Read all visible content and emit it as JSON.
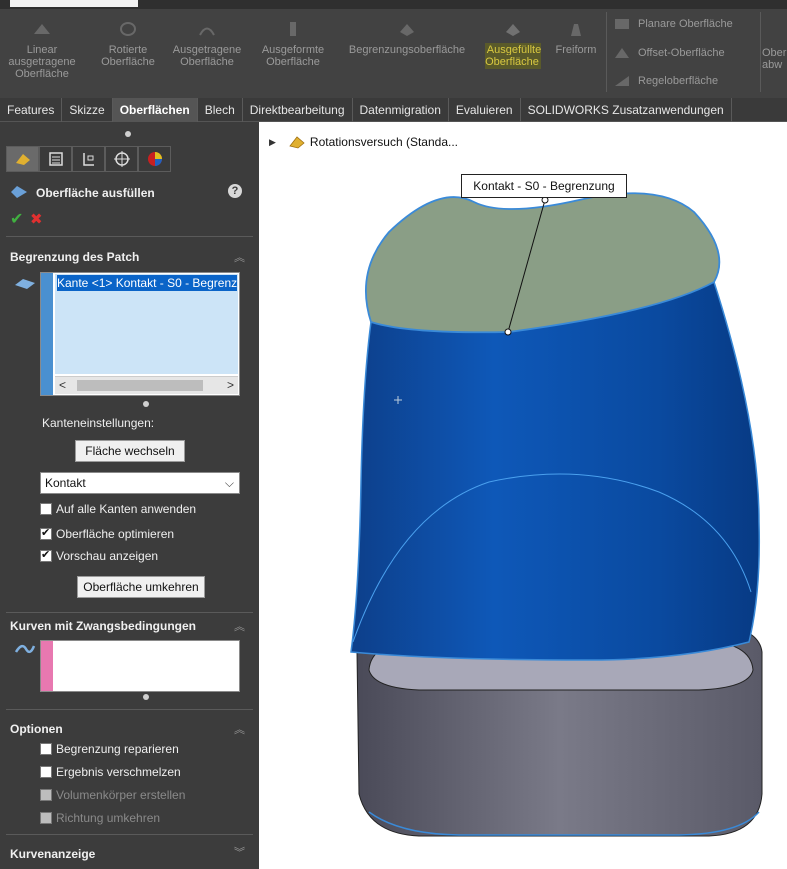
{
  "ribbon": {
    "buttons": [
      {
        "label": "Linear ausgetragene Oberfläche",
        "icon": "linear-sweep-surface-icon"
      },
      {
        "label": "Rotierte Oberfläche",
        "icon": "revolved-surface-icon"
      },
      {
        "label": "Ausgetragene Oberfläche",
        "icon": "swept-surface-icon"
      },
      {
        "label": "Ausgeformte Oberfläche",
        "icon": "lofted-surface-icon"
      },
      {
        "label": "Begrenzungsoberfläche",
        "icon": "boundary-surface-icon"
      },
      {
        "label": "Ausgefüllte Oberfläche",
        "icon": "filled-surface-icon"
      },
      {
        "label": "Freiform",
        "icon": "freeform-icon"
      }
    ],
    "small_buttons": [
      "Planare Oberfläche",
      "Offset-Oberfläche",
      "Regeloberfläche"
    ],
    "overflow_top": "Ober",
    "overflow_bottom": "abw"
  },
  "tabs": [
    "Features",
    "Skizze",
    "Oberflächen",
    "Blech",
    "Direktbearbeitung",
    "Datenmigration",
    "Evaluieren",
    "SOLIDWORKS Zusatzanwendungen"
  ],
  "active_tab": "Oberflächen",
  "panel": {
    "title": "Oberfläche ausfüllen",
    "help_glyph": "?",
    "ok_glyph": "✔",
    "cancel_glyph": "✖",
    "patch_boundary": {
      "title": "Begrenzung des Patch",
      "list_item": "Kante <1> Kontakt - S0 - Begrenz",
      "scroll_left": "<",
      "scroll_right": ">",
      "edge_settings_label": "Kanteneinstellungen:",
      "alternate_face_button": "Fläche wechseln",
      "curvature_select": "Kontakt",
      "apply_all_edges": "Auf alle Kanten anwenden",
      "optimize_surface": "Oberfläche optimieren",
      "show_preview": "Vorschau anzeigen",
      "reverse_surface_button": "Oberfläche umkehren"
    },
    "constraint_curves": {
      "title": "Kurven mit Zwangsbedingungen"
    },
    "options": {
      "title": "Optionen",
      "fix_up_boundary": "Begrenzung reparieren",
      "merge_result": "Ergebnis verschmelzen",
      "create_solid": "Volumenkörper erstellen",
      "reverse_direction": "Richtung umkehren"
    },
    "curve_display": {
      "title": "Kurvenanzeige"
    }
  },
  "viewport": {
    "tree_label": "Rotationsversuch  (Standa...",
    "callout": "Kontakt - S0 - Begrenzung"
  },
  "colors": {
    "panel_bg": "#3c3c3c",
    "ribbon_bg": "#424242",
    "surface_blue": "#0a4fa8",
    "patch_preview": "#8a9e86",
    "selection_blue": "#0a64c8"
  }
}
